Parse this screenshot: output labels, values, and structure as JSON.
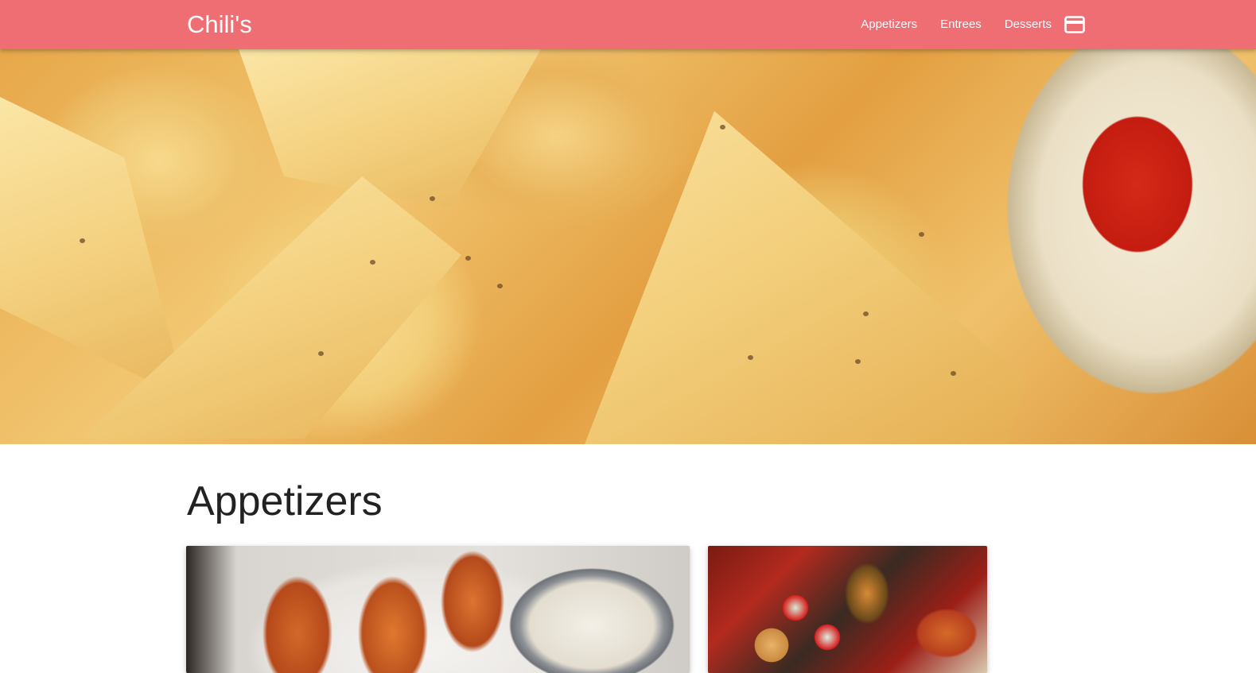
{
  "navbar": {
    "brand": "Chili's",
    "links": [
      "Appetizers",
      "Entrees",
      "Desserts"
    ],
    "cart_icon": "credit-card-icon",
    "background": "#ee6e73"
  },
  "hero": {
    "image": "tortilla-chips-with-salsa"
  },
  "section": {
    "title": "Appetizers",
    "cards": [
      {
        "image": "buffalo-wings-with-dip"
      },
      {
        "image": "appetizer-sampler-platter"
      }
    ]
  }
}
